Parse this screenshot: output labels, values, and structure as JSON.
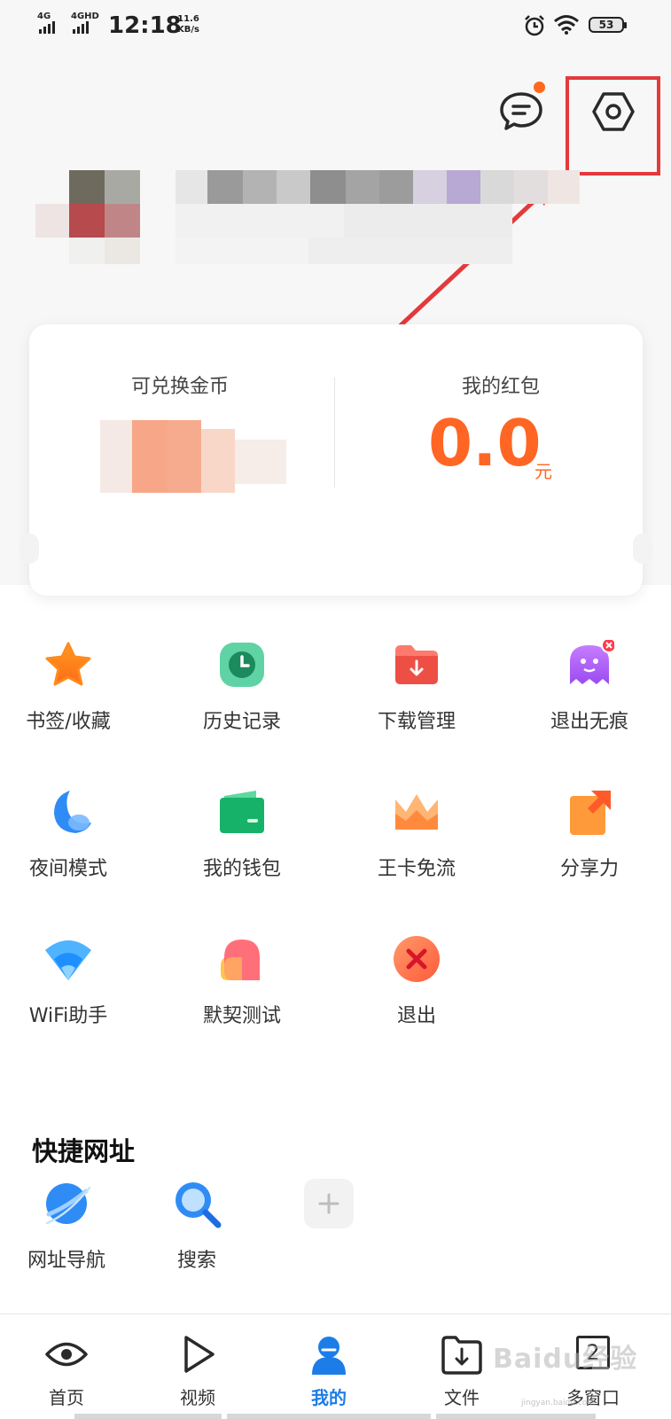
{
  "status_bar": {
    "signal1": "4G",
    "signal2": "4GHD",
    "time": "12:18",
    "speed_value": "11.6",
    "speed_unit": "KB/s",
    "battery": "53"
  },
  "header": {
    "message_icon": "chat-bubble-icon",
    "settings_icon": "hexagon-settings-icon",
    "message_badge": true
  },
  "card": {
    "coins_label": "可兑换金币",
    "redpacket_label": "我的红包",
    "redpacket_value": "0.0",
    "redpacket_unit": "元"
  },
  "features": [
    {
      "label": "书签/收藏",
      "icon": "star-icon"
    },
    {
      "label": "历史记录",
      "icon": "clock-icon"
    },
    {
      "label": "下载管理",
      "icon": "download-folder-icon"
    },
    {
      "label": "退出无痕",
      "icon": "ghost-icon"
    },
    {
      "label": "夜间模式",
      "icon": "moon-icon"
    },
    {
      "label": "我的钱包",
      "icon": "wallet-icon"
    },
    {
      "label": "王卡免流",
      "icon": "crown-icon"
    },
    {
      "label": "分享力",
      "icon": "share-icon"
    },
    {
      "label": "WiFi助手",
      "icon": "wifi-icon"
    },
    {
      "label": "默契测试",
      "icon": "heart-icon"
    },
    {
      "label": "退出",
      "icon": "exit-x-icon"
    }
  ],
  "shortcuts": {
    "title": "快捷网址",
    "items": [
      {
        "label": "网址导航",
        "icon": "planet-icon"
      },
      {
        "label": "搜索",
        "icon": "search-icon"
      },
      {
        "label": "",
        "icon": "add-icon"
      }
    ]
  },
  "bottom_nav": [
    {
      "label": "首页",
      "icon": "eye-icon"
    },
    {
      "label": "视频",
      "icon": "play-icon"
    },
    {
      "label": "我的",
      "icon": "profile-icon"
    },
    {
      "label": "文件",
      "icon": "file-download-icon"
    },
    {
      "label": "多窗口",
      "icon": "windows-icon",
      "count": "2"
    }
  ],
  "watermark": {
    "text": "Baidu经验",
    "url": "jingyan.baidu.com"
  },
  "colors": {
    "accent": "#1d7de8",
    "orange": "#ff6624",
    "highlight": "#e4393c"
  }
}
